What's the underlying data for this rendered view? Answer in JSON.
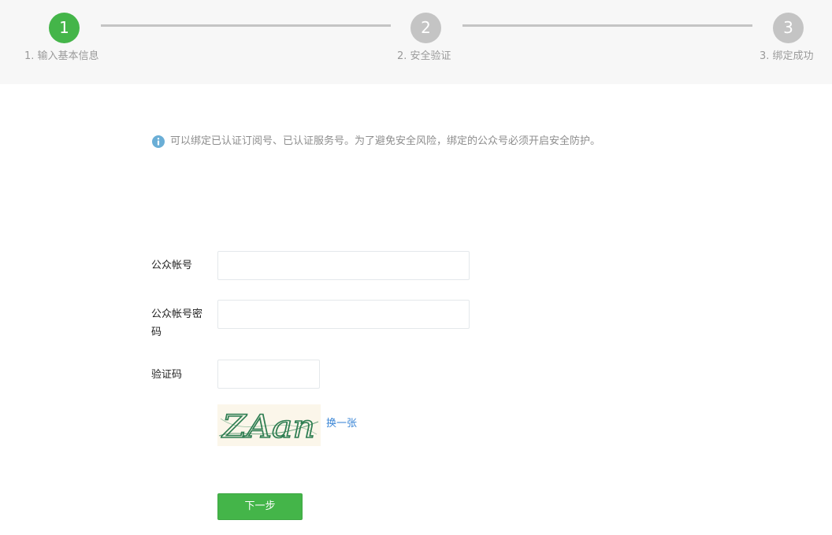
{
  "stepper": {
    "steps": [
      {
        "number": "1",
        "label": "1. 输入基本信息",
        "state": "active"
      },
      {
        "number": "2",
        "label": "2. 安全验证",
        "state": "pending"
      },
      {
        "number": "3",
        "label": "3. 绑定成功",
        "state": "pending"
      }
    ]
  },
  "notice": {
    "icon": "info-icon",
    "text": "可以绑定已认证订阅号、已认证服务号。为了避免安全风险，绑定的公众号必须开启安全防护。"
  },
  "form": {
    "account_label": "公众帐号",
    "account_value": "",
    "password_label": "公众帐号密码",
    "password_value": "",
    "captcha_label": "验证码",
    "captcha_value": "",
    "captcha_image_text": "ZAan",
    "refresh_label": "换一张",
    "next_label": "下一步"
  },
  "colors": {
    "accent": "#44b549",
    "inactive_step": "#c4c4c4",
    "link": "#3b86d6",
    "info_icon": "#6aaed6"
  }
}
